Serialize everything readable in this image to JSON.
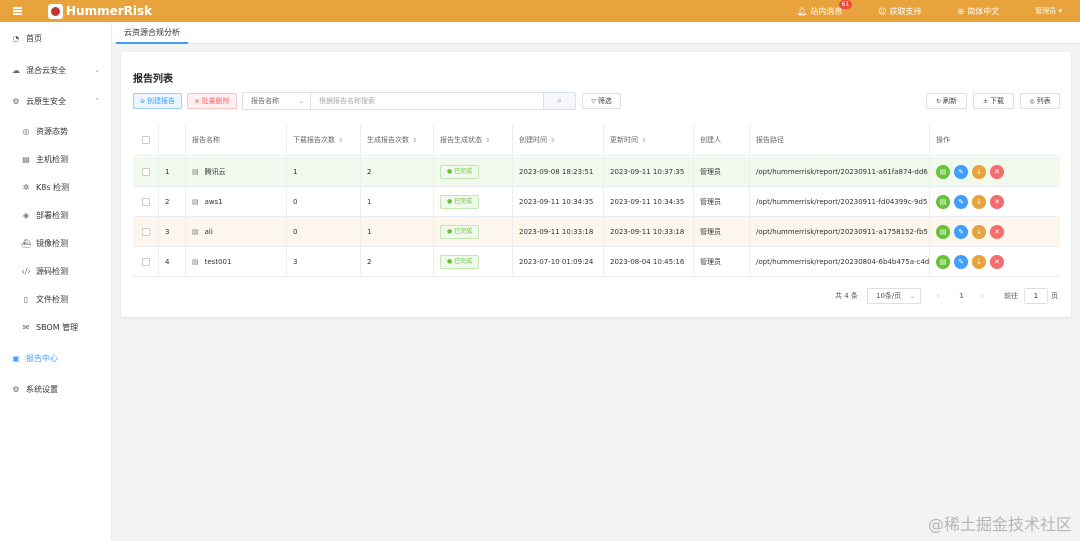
{
  "header": {
    "app_name": "HummerRisk",
    "messages_label": "站内消息",
    "messages_badge": "61",
    "support_label": "获取支持",
    "language_label": "简体中文",
    "user_label": "管理员"
  },
  "sidebar": {
    "items": [
      {
        "label": "首页",
        "icon": "dashboard-icon"
      },
      {
        "label": "混合云安全",
        "icon": "cloud-icon"
      },
      {
        "label": "云原生安全",
        "icon": "cloud-native-icon"
      },
      {
        "label": "资源态势",
        "icon": "resource-icon"
      },
      {
        "label": "主机检测",
        "icon": "host-icon"
      },
      {
        "label": "K8s 检测",
        "icon": "k8s-icon"
      },
      {
        "label": "部署检测",
        "icon": "deploy-icon"
      },
      {
        "label": "镜像检测",
        "icon": "image-icon"
      },
      {
        "label": "源码检测",
        "icon": "code-icon"
      },
      {
        "label": "文件检测",
        "icon": "file-icon"
      },
      {
        "label": "SBOM 管理",
        "icon": "sbom-icon"
      },
      {
        "label": "报告中心",
        "icon": "report-icon"
      },
      {
        "label": "系统设置",
        "icon": "settings-icon"
      }
    ]
  },
  "tabs": {
    "active": "云资源合规分析"
  },
  "card": {
    "title": "报告列表",
    "create_label": "创建报告",
    "delete_label": "批量删除",
    "search_field": "报告名称",
    "search_placeholder": "根据报告名称搜索",
    "filter_label": "筛选",
    "refresh_label": "刷新",
    "download_label": "下载",
    "columns_label": "列表"
  },
  "table": {
    "headers": {
      "name": "报告名称",
      "downloads": "下载报告次数",
      "generated": "生成报告次数",
      "status": "报告生成状态",
      "created": "创建时间",
      "updated": "更新时间",
      "creator": "创建人",
      "path": "报告路径",
      "actions": "操作"
    },
    "rows": [
      {
        "index": "1",
        "name": "腾讯云",
        "downloads": "1",
        "generated": "2",
        "status": "已完成",
        "created": "2023-09-08 18:23:51",
        "updated": "2023-09-11 10:37:35",
        "creator": "管理员",
        "path": "/opt/hummerrisk/report/20230911-a61fa874-dd6"
      },
      {
        "index": "2",
        "name": "aws1",
        "downloads": "0",
        "generated": "1",
        "status": "已完成",
        "created": "2023-09-11 10:34:35",
        "updated": "2023-09-11 10:34:35",
        "creator": "管理员",
        "path": "/opt/hummerrisk/report/20230911-fd04399c-9d5"
      },
      {
        "index": "3",
        "name": "ali",
        "downloads": "0",
        "generated": "1",
        "status": "已完成",
        "created": "2023-09-11 10:33:18",
        "updated": "2023-09-11 10:33:18",
        "creator": "管理员",
        "path": "/opt/hummerrisk/report/20230911-a1758152-fb5"
      },
      {
        "index": "4",
        "name": "test001",
        "downloads": "3",
        "generated": "2",
        "status": "已完成",
        "created": "2023-07-10 01:09:24",
        "updated": "2023-08-04 10:45:16",
        "creator": "管理员",
        "path": "/opt/hummerrisk/report/20230804-6b4b475a-c4d"
      }
    ]
  },
  "pagination": {
    "total": "共 4 条",
    "page_size": "10条/页",
    "current_page": "1",
    "goto_label": "前往",
    "goto_value": "1",
    "page_suffix": "页"
  },
  "watermark": "@稀土掘金技术社区",
  "colors": {
    "header_bg": "#e8a33d",
    "accent": "#409eff",
    "success": "#67c23a",
    "warning": "#e6a23c",
    "danger": "#f56c6c"
  }
}
